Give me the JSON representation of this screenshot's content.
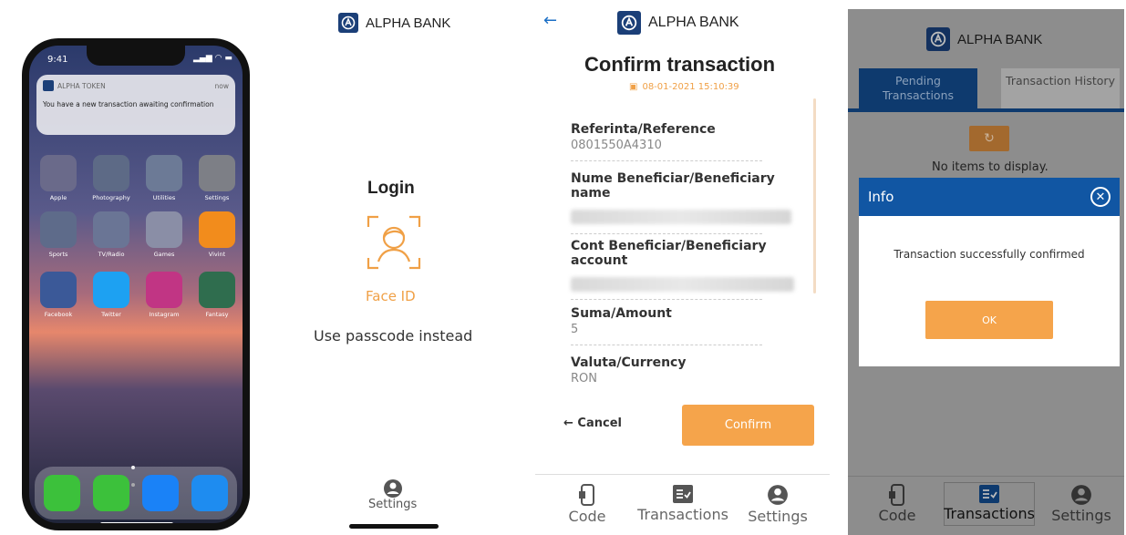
{
  "panel1": {
    "time": "9:41",
    "notification": {
      "app": "ALPHA TOKEN",
      "time": "now",
      "message": "You have a new transaction awaiting confirmation"
    },
    "apps": [
      {
        "label": "Apple",
        "color": "#6a6a8a"
      },
      {
        "label": "Photography",
        "color": "#5d6a86"
      },
      {
        "label": "Utilities",
        "color": "#6c7a96"
      },
      {
        "label": "Settings",
        "color": "#7d7f86"
      },
      {
        "label": "Sports",
        "color": "#5e6b8a"
      },
      {
        "label": "TV/Radio",
        "color": "#6a7595"
      },
      {
        "label": "Games",
        "color": "#8a8ea6"
      },
      {
        "label": "Vivint",
        "color": "#f28c1c"
      },
      {
        "label": "Facebook",
        "color": "#3b5998"
      },
      {
        "label": "Twitter",
        "color": "#1da1f2"
      },
      {
        "label": "Instagram",
        "color": "#c13584"
      },
      {
        "label": "Fantasy",
        "color": "#2f6d4e"
      }
    ],
    "dock": [
      {
        "name": "phone-icon",
        "color": "#3cc13b"
      },
      {
        "name": "messages-icon",
        "color": "#3cc13b"
      },
      {
        "name": "mail-icon",
        "color": "#1a82f7"
      },
      {
        "name": "safari-icon",
        "color": "#1e8cf0"
      }
    ]
  },
  "panel2": {
    "bank": "ALPHA BANK",
    "title": "Login",
    "face_id": "Face ID",
    "passcode": "Use passcode instead",
    "settings": "Settings"
  },
  "panel3": {
    "bank": "ALPHA BANK",
    "title": "Confirm transaction",
    "date": "08-01-2021 15:10:39",
    "fields": [
      {
        "label": "Referinta/Reference",
        "value": "0801550A4310"
      },
      {
        "label": "Nume Beneficiar/Beneficiary name",
        "value": ""
      },
      {
        "label": "Cont Beneficiar/Beneficiary account",
        "value": ""
      },
      {
        "label": "Suma/Amount",
        "value": "5"
      },
      {
        "label": "Valuta/Currency",
        "value": "RON"
      }
    ],
    "cancel": "← Cancel",
    "confirm": "Confirm",
    "nav": [
      "Code",
      "Transactions",
      "Settings"
    ]
  },
  "panel4": {
    "bank": "ALPHA BANK",
    "tabs": [
      "Pending Transactions",
      "Transaction History"
    ],
    "empty": "No items to display.",
    "dialog": {
      "title": "Info",
      "message": "Transaction successfully confirmed",
      "ok": "OK"
    },
    "nav": [
      "Code",
      "Transactions",
      "Settings"
    ]
  }
}
